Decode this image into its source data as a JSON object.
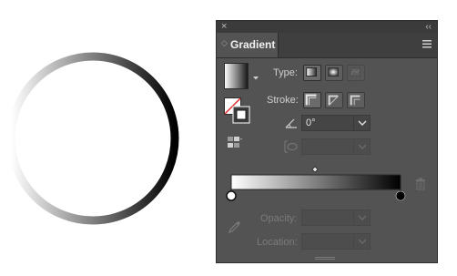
{
  "panel": {
    "close_glyph": "×",
    "collapse_glyph": "‹‹",
    "tab_title": "Gradient",
    "grip_glyph": "◇",
    "type_label": "Type:",
    "stroke_label": "Stroke:",
    "angle_value": "0°",
    "opacity_label": "Opacity:",
    "location_label": "Location:"
  },
  "gradient": {
    "start_color": "#ffffff",
    "end_color": "#000000",
    "midpoint_percent": 50
  },
  "icons": {
    "close": "close-icon",
    "collapse": "collapse-icon",
    "menu": "panel-menu-icon",
    "angle": "angle-icon",
    "aspect": "aspect-ratio-icon",
    "eyedropper": "eyedropper-icon",
    "trash": "trash-icon"
  }
}
